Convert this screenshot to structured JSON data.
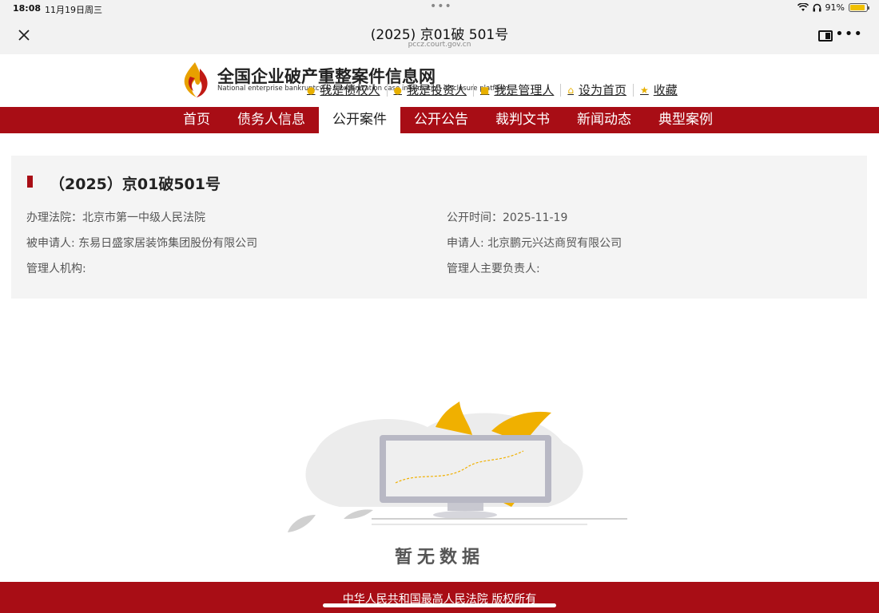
{
  "status_bar": {
    "time": "18:08",
    "date": "11月19日周三",
    "battery": "91%"
  },
  "nav": {
    "title": "(2025) 京01破 501号",
    "subtitle": "pccz.court.gov.cn"
  },
  "header": {
    "logo_cn": "全国企业破产重整案件信息网",
    "logo_en": "National enterprise bankruptcy & reorganization case information disclosure platform",
    "links": [
      {
        "label": "我是债权人",
        "icon": "user-icon"
      },
      {
        "label": "我是投资人",
        "icon": "coin-icon"
      },
      {
        "label": "我是管理人",
        "icon": "badge-icon"
      },
      {
        "label": "设为首页",
        "icon": "home-icon"
      },
      {
        "label": "收藏",
        "icon": "star-icon"
      }
    ]
  },
  "menu": [
    "首页",
    "债务人信息",
    "公开案件",
    "公开公告",
    "裁判文书",
    "新闻动态",
    "典型案例"
  ],
  "menu_active": "公开案件",
  "case": {
    "title": "（2025）京01破501号",
    "court": "办理法院：北京市第一中级人民法院",
    "public_time": "公开时间：2025-11-19",
    "respondent": "被申请人: 东易日盛家居装饰集团股份有限公司",
    "applicant": "申请人: 北京鹏元兴达商贸有限公司",
    "admin_org": "管理人机构:",
    "admin_head": "管理人主要负责人:"
  },
  "empty_text": "暂无数据",
  "footer": "中华人民共和国最高人民法院 版权所有",
  "colors": {
    "brand_red": "#a80d15",
    "accent_gold": "#e8b000"
  }
}
